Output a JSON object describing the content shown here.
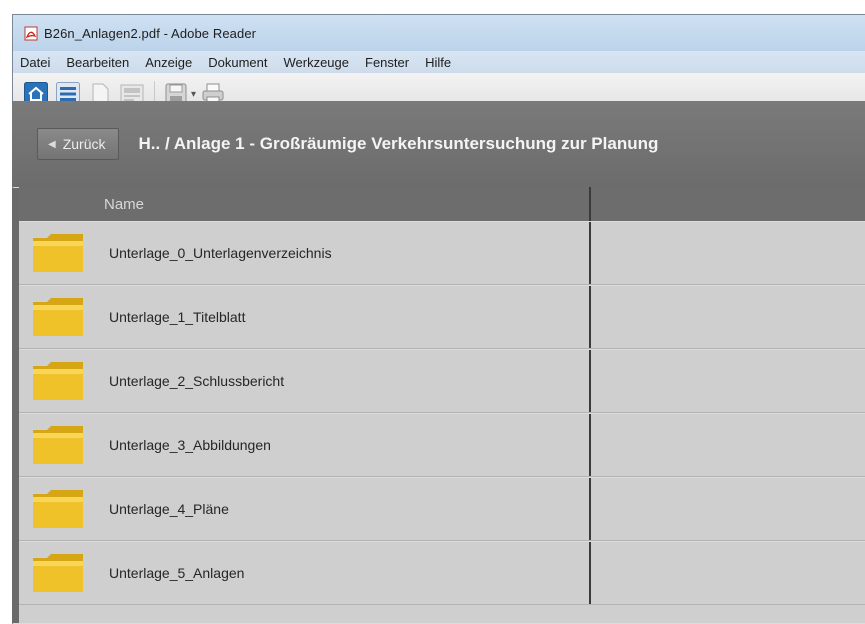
{
  "window": {
    "title": "B26n_Anlagen2.pdf - Adobe Reader"
  },
  "menubar": {
    "items": [
      {
        "label": "Datei"
      },
      {
        "label": "Bearbeiten"
      },
      {
        "label": "Anzeige"
      },
      {
        "label": "Dokument"
      },
      {
        "label": "Werkzeuge"
      },
      {
        "label": "Fenster"
      },
      {
        "label": "Hilfe"
      }
    ]
  },
  "toolbar": {
    "icons": [
      "home-icon",
      "list-view-icon",
      "page-view-icon",
      "layout-view-icon",
      "save-icon",
      "dropdown-arrow-icon",
      "print-icon"
    ]
  },
  "navbar": {
    "back_label": "Zurück",
    "breadcrumb": "H.. / Anlage 1 - Großräumige Verkehrsuntersuchung zur Planung"
  },
  "list": {
    "column_name": "Name",
    "items": [
      {
        "label": "Unterlage_0_Unterlagenverzeichnis"
      },
      {
        "label": "Unterlage_1_Titelblatt"
      },
      {
        "label": "Unterlage_2_Schlussbericht"
      },
      {
        "label": "Unterlage_3_Abbildungen"
      },
      {
        "label": "Unterlage_4_Pläne"
      },
      {
        "label": "Unterlage_5_Anlagen"
      }
    ]
  },
  "colors": {
    "folder": "#e9b81f",
    "navbar": "#737373",
    "accent": "#1f6fb8"
  }
}
